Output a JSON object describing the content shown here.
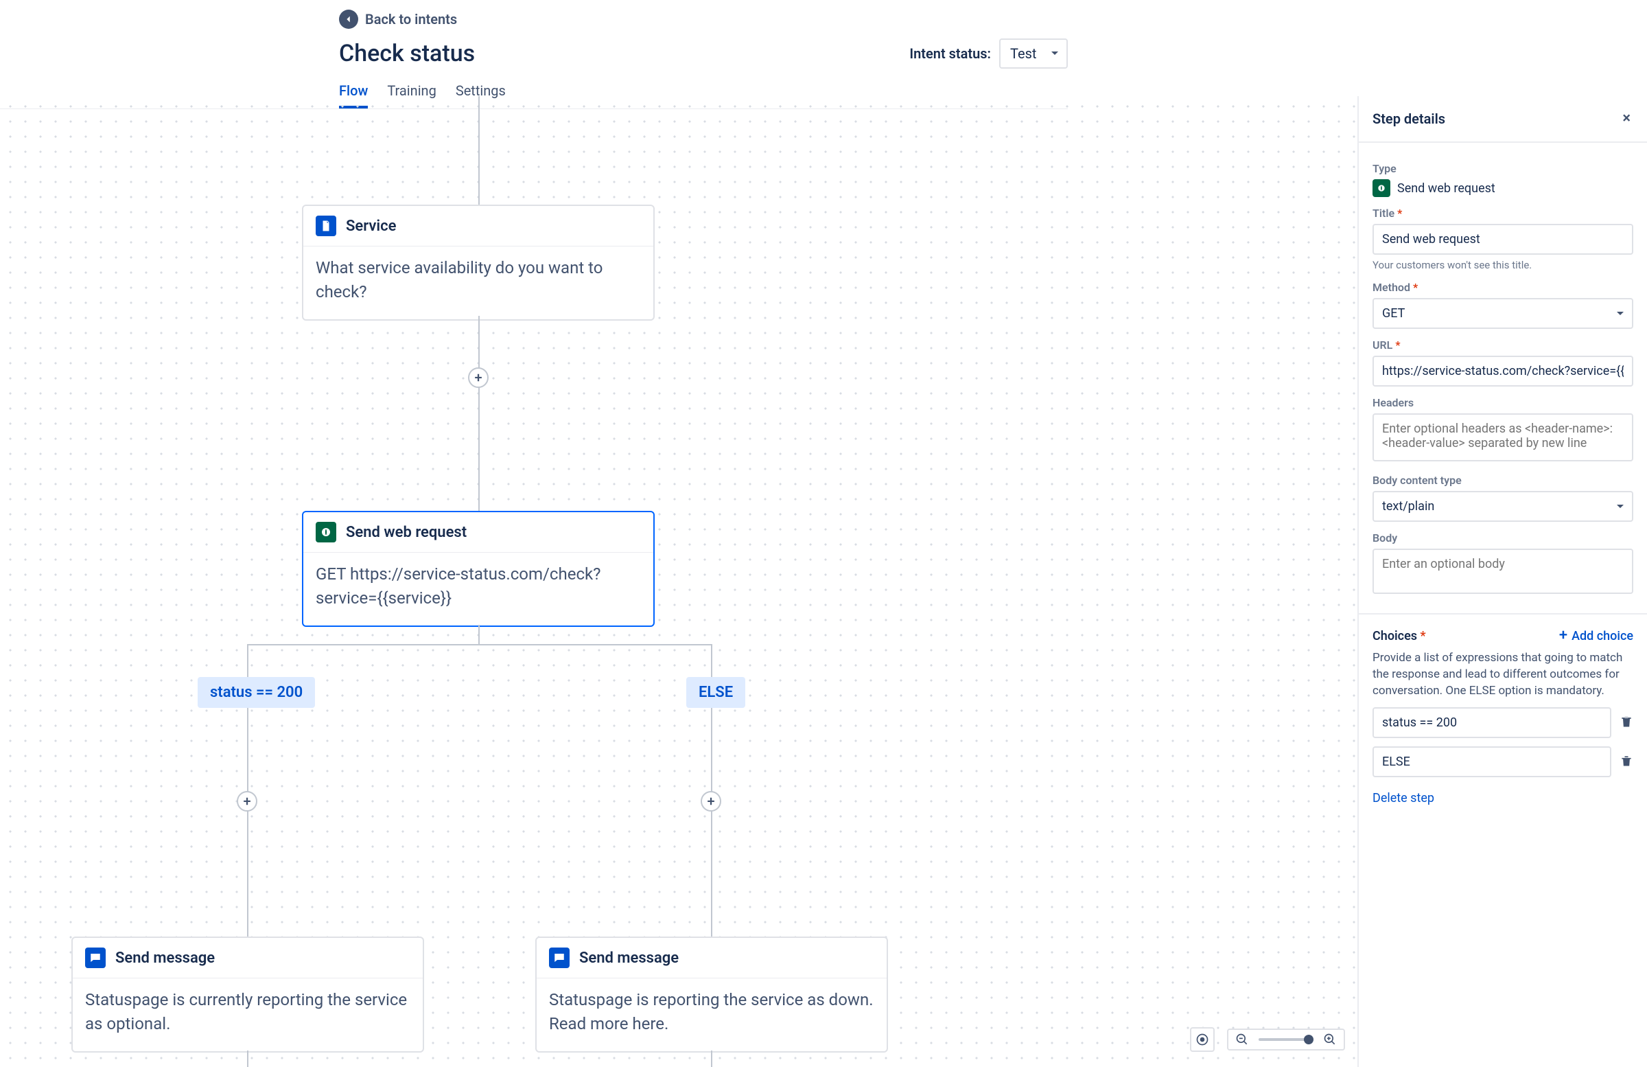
{
  "header": {
    "back_label": "Back to intents",
    "title": "Check status",
    "intent_status_label": "Intent status:",
    "intent_status_value": "Test",
    "tabs": {
      "flow": "Flow",
      "training": "Training",
      "settings": "Settings"
    }
  },
  "nodes": {
    "service": {
      "title": "Service",
      "body": "What service availability do you want to check?"
    },
    "webreq": {
      "title": "Send web request",
      "body": "GET https://service-status.com/check?service={{service}}"
    },
    "branch_left": "status == 200",
    "branch_right": "ELSE",
    "msg_left": {
      "title": "Send message",
      "body": "Statuspage is currently reporting the service as optional."
    },
    "msg_right": {
      "title": "Send message",
      "body": "Statuspage is reporting the service as down. Read more here."
    }
  },
  "panel": {
    "header": "Step details",
    "type_label": "Type",
    "type_value": "Send web request",
    "title_label": "Title",
    "title_value": "Send web request",
    "title_hint": "Your customers won't see this title.",
    "method_label": "Method",
    "method_value": "GET",
    "url_label": "URL",
    "url_value": "https://service-status.com/check?service={{service}",
    "headers_label": "Headers",
    "headers_placeholder": "Enter optional headers as <header-name>: <header-value> separated by new line",
    "body_type_label": "Body content type",
    "body_type_value": "text/plain",
    "body_label": "Body",
    "body_placeholder": "Enter an optional body",
    "choices_label": "Choices",
    "add_choice": "Add choice",
    "choices_desc": "Provide a list of expressions that going to match the response and lead to different outcomes for conversation. One ELSE option is mandatory.",
    "choices": [
      "status == 200",
      "ELSE"
    ],
    "delete_step": "Delete step"
  }
}
